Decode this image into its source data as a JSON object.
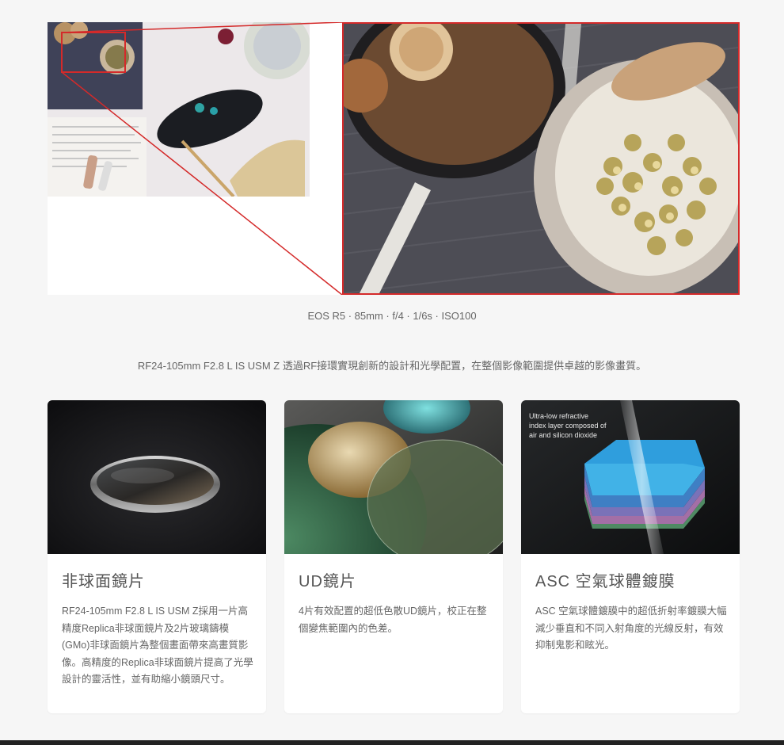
{
  "hero": {
    "caption": "EOS R5 · 85mm · f/4 · 1/6s · ISO100",
    "highlight_color": "#d42a2a"
  },
  "intro": "RF24-105mm F2.8 L IS USM Z 透過RF接環實現創新的設計和光學配置，在整個影像範圍提供卓越的影像畫質。",
  "cards": [
    {
      "title": "非球面鏡片",
      "body": "RF24-105mm F2.8 L IS USM Z採用一片高精度Replica非球面鏡片及2片玻璃鑄模(GMo)非球面鏡片為整個畫面帶來高畫質影像。高精度的Replica非球面鏡片提高了光學設計的靈活性，並有助縮小鏡頭尺寸。"
    },
    {
      "title": "UD鏡片",
      "body": "4片有效配置的超低色散UD鏡片，校正在整個變焦範圍內的色差。"
    },
    {
      "title": "ASC 空氣球體鍍膜",
      "body": "ASC 空氣球體鍍膜中的超低折射率鍍膜大幅減少垂直和不同入射角度的光線反射，有效抑制鬼影和眩光。",
      "image_label_lines": [
        "Ultra-low refractive",
        "index layer composed of",
        "air and silicon dioxide"
      ]
    }
  ]
}
